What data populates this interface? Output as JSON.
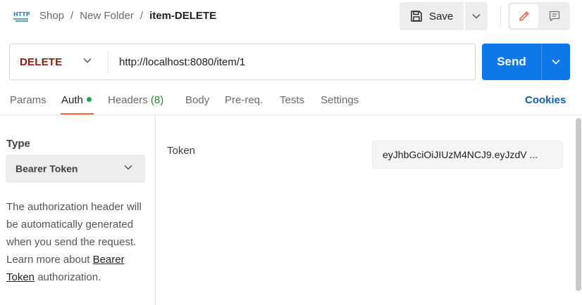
{
  "header": {
    "icon": "http-request-icon",
    "icon_text": "HTTP",
    "breadcrumb": [
      "Shop",
      "New Folder"
    ],
    "breadcrumb_separator": "/",
    "current": "item-DELETE",
    "save_label": "Save"
  },
  "request": {
    "method": "DELETE",
    "method_color": "#8e1a10",
    "url": "http://localhost:8080/item/1",
    "send_label": "Send",
    "send_color": "#0f78e8"
  },
  "tabs": {
    "items": [
      {
        "label": "Params"
      },
      {
        "label": "Auth",
        "active": true,
        "indicator": "green-dot"
      },
      {
        "label": "Headers",
        "count": "(8)"
      },
      {
        "label": "Body"
      },
      {
        "label": "Pre-req."
      },
      {
        "label": "Tests"
      },
      {
        "label": "Settings"
      }
    ],
    "cookies_label": "Cookies",
    "accent_color": "#f26b3a"
  },
  "auth": {
    "type_label": "Type",
    "type_value": "Bearer Token",
    "description_before": "The authorization header will be automatically generated when you send the request. Learn more about ",
    "description_link": "Bearer Token",
    "description_after": " authorization.",
    "token_label": "Token",
    "token_value": "eyJhbGciOiJIUzM4NCJ9.eyJzdV ..."
  }
}
